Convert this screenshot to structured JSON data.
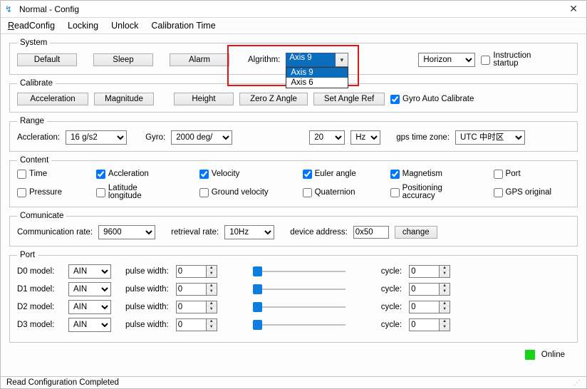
{
  "window": {
    "title": "Normal - Config",
    "close_glyph": "✕",
    "icon_glyph": "↯"
  },
  "menu": {
    "readconfig": "ReadConfig",
    "locking": "Locking",
    "unlock": "Unlock",
    "calibration_time": "Calibration Time"
  },
  "system": {
    "legend": "System",
    "default": "Default",
    "sleep": "Sleep",
    "alarm": "Alarm",
    "algrithm_label": "Algrithm:",
    "algrithm_value": "Axis 9",
    "algrithm_options": [
      "Axis 9",
      "Axis 6"
    ],
    "horizon": "Horizon",
    "instruction_startup": "Instruction startup",
    "instruction_checked": false
  },
  "calibrate": {
    "legend": "Calibrate",
    "acceleration": "Acceleration",
    "magnitude": "Magnitude",
    "height": "Height",
    "zero_z_angle": "Zero Z Angle",
    "set_angle_ref": "Set Angle Ref",
    "gyro_auto": "Gyro Auto Calibrate",
    "gyro_auto_checked": true
  },
  "range": {
    "legend": "Range",
    "accleration_label": "Accleration:",
    "accleration_value": "16 g/s2",
    "gyro_label": "Gyro:",
    "gyro_value": "2000 deg/",
    "rate_value": "20",
    "rate_unit": "Hz",
    "gps_tz_label": "gps time zone:",
    "gps_tz_value": "UTC 中时区"
  },
  "content_section": {
    "legend": "Content",
    "items": [
      {
        "label": "Time",
        "checked": false
      },
      {
        "label": "Accleration",
        "checked": true
      },
      {
        "label": "Velocity",
        "checked": true
      },
      {
        "label": "Euler angle",
        "checked": true
      },
      {
        "label": "Magnetism",
        "checked": true
      },
      {
        "label": "Port",
        "checked": false
      },
      {
        "label": "Pressure",
        "checked": false
      },
      {
        "label": "Latitude longitude",
        "checked": false
      },
      {
        "label": "Ground velocity",
        "checked": false
      },
      {
        "label": "Quaternion",
        "checked": false
      },
      {
        "label": "Positioning accuracy",
        "checked": false
      },
      {
        "label": "GPS original",
        "checked": false
      }
    ]
  },
  "comm": {
    "legend": "Comunicate",
    "rate_label": "Communication rate:",
    "rate_value": "9600",
    "retrieval_label": "retrieval rate:",
    "retrieval_value": "10Hz",
    "addr_label": "device address:",
    "addr_value": "0x50",
    "change": "change"
  },
  "port": {
    "legend": "Port",
    "pulse_width_label": "pulse width:",
    "cycle_label": "cycle:",
    "rows": [
      {
        "label": "D0 model:",
        "model": "AIN",
        "pw": "0",
        "cycle": "0"
      },
      {
        "label": "D1 model:",
        "model": "AIN",
        "pw": "0",
        "cycle": "0"
      },
      {
        "label": "D2 model:",
        "model": "AIN",
        "pw": "0",
        "cycle": "0"
      },
      {
        "label": "D3 model:",
        "model": "AIN",
        "pw": "0",
        "cycle": "0"
      }
    ]
  },
  "footer": {
    "online": "Online",
    "status": "Read Configuration Completed"
  }
}
